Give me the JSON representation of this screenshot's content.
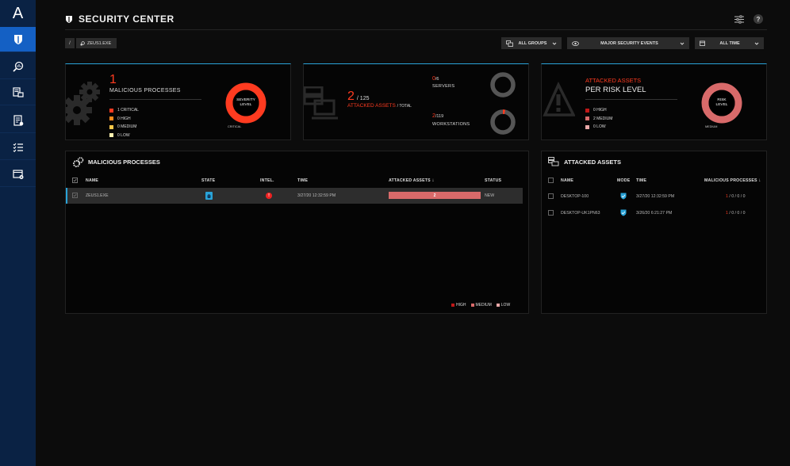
{
  "app": {
    "logo": "A"
  },
  "sidebar": {
    "items": [
      {
        "icon": "shield-icon",
        "active": true
      },
      {
        "icon": "search-analytics-icon",
        "active": false
      },
      {
        "icon": "assets-icon",
        "active": false
      },
      {
        "icon": "report-icon",
        "active": false
      },
      {
        "icon": "checklist-icon",
        "active": false
      },
      {
        "icon": "settings-window-icon",
        "active": false
      }
    ]
  },
  "header": {
    "title": "SECURITY CENTER",
    "help": "?"
  },
  "breadcrumb": {
    "root": "/",
    "item": "ZEUS1.EXE"
  },
  "filters": {
    "groups": "ALL GROUPS",
    "events": "MAJOR SECURITY EVENTS",
    "time": "ALL TIME"
  },
  "summary_processes": {
    "count": "1",
    "label": "MALICIOUS PROCESSES",
    "legend": [
      {
        "label": "1 CRITICAL",
        "color": "#ff3b20"
      },
      {
        "label": "0 HIGH",
        "color": "#ff8a1c"
      },
      {
        "label": "0 MEDIUM",
        "color": "#ffc94a"
      },
      {
        "label": "0 LOW",
        "color": "#fff3b0"
      }
    ],
    "donut_label_1": "SEVERITY",
    "donut_label_2": "LEVEL",
    "donut_caption": "CRITICAL"
  },
  "summary_assets": {
    "count": "2",
    "total": "/ 125",
    "label": "ATTACKED ASSETS",
    "label_suffix": "/ TOTAL",
    "servers_count": "0",
    "servers_total": "/6",
    "servers_label": "SERVERS",
    "workstations_count": "2",
    "workstations_total": "/119",
    "workstations_label": "WORKSTATIONS"
  },
  "summary_risk": {
    "title_1": "ATTACKED ASSETS",
    "title_2": "PER RISK LEVEL",
    "legend": [
      {
        "label": "0 HIGH",
        "color": "#c01818"
      },
      {
        "label": "2 MEDIUM",
        "color": "#d86a6a"
      },
      {
        "label": "0 LOW",
        "color": "#eaa8a8"
      }
    ],
    "donut_label_1": "RISK",
    "donut_label_2": "LEVEL",
    "donut_caption": "MEDIUM"
  },
  "processes_panel": {
    "title": "MALICIOUS PROCESSES",
    "columns": [
      "NAME",
      "STATE",
      "INTEL.",
      "TIME",
      "ATTACKED ASSETS",
      "STATUS"
    ],
    "rows": [
      {
        "name": "ZEUS1.EXE",
        "time": "3/27/20 12:32:59 PM",
        "assets": "2",
        "status": "NEW"
      }
    ],
    "legend": [
      "HIGH",
      "MEDIUM",
      "LOW"
    ],
    "legend_colors": [
      "#c01818",
      "#d86a6a",
      "#eaa8a8"
    ]
  },
  "assets_panel": {
    "title": "ATTACKED ASSETS",
    "columns": [
      "NAME",
      "MODE",
      "TIME",
      "MALICIOUS PROCESSES"
    ],
    "rows": [
      {
        "name": "DESKTOP-100",
        "time": "3/27/20 12:32:59 PM",
        "first": "1",
        "rest": "/ 0 / 0 / 0"
      },
      {
        "name": "DESKTOP-UK1PN63",
        "time": "3/26/20 6:21:27 PM",
        "first": "1",
        "rest": "/ 0 / 0 / 0"
      }
    ]
  }
}
